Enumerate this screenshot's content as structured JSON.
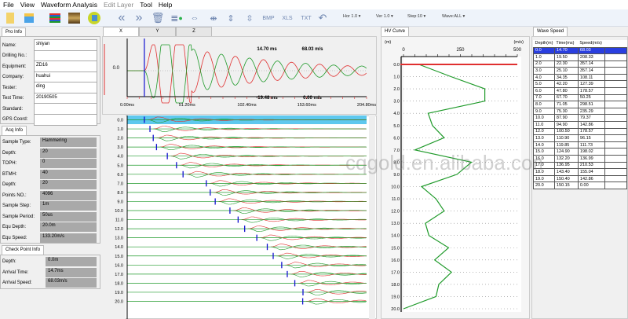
{
  "menu": [
    "File",
    "View",
    "Waveform Analysis",
    "Edit Layer",
    "Tool",
    "Help"
  ],
  "toolbar": {
    "icons": [
      "new-file-icon",
      "save-icon",
      "waveform-icon",
      "layer-image-icon",
      "report-icon",
      "prev-icon",
      "next-icon",
      "delete-icon",
      "add-layer-icon",
      "h-expand-icon",
      "h-shrink-icon",
      "v-expand-icon",
      "v-shrink-icon"
    ],
    "bmp": "BMP",
    "xls": "XLS",
    "txt": "TXT",
    "hor": "Hor 1.0",
    "ver": "Ver 1.0",
    "step": "Step:10",
    "wave": "Wave:ALL"
  },
  "pro_info": {
    "tab": "Pro Info",
    "fields": [
      {
        "label": "Name:",
        "value": "shiyan"
      },
      {
        "label": "Drilling No.:",
        "value": ""
      },
      {
        "label": "Equipment:",
        "value": "ZD16"
      },
      {
        "label": "Company:",
        "value": "huahui"
      },
      {
        "label": "Tester:",
        "value": "ding"
      },
      {
        "label": "Test Time:",
        "value": "20190505"
      },
      {
        "label": "Standard:",
        "value": ""
      },
      {
        "label": "GPS Coord:",
        "value": ""
      }
    ]
  },
  "acq_info": {
    "tab": "Acq Info",
    "fields": [
      {
        "label": "Sample Type:",
        "value": "Hammering"
      },
      {
        "label": "Depth:",
        "value": "20"
      },
      {
        "label": "TOPH:",
        "value": "0"
      },
      {
        "label": "BTMH:",
        "value": "40"
      },
      {
        "label": "Depth:",
        "value": "20"
      },
      {
        "label": "Points NO.:",
        "value": "4096"
      },
      {
        "label": "Sample Step:",
        "value": "1m"
      },
      {
        "label": "Sample Period:",
        "value": "50us"
      },
      {
        "label": "Equ Depth:",
        "value": "20.0m"
      },
      {
        "label": "Equ Speed:",
        "value": "133.20m/s"
      }
    ]
  },
  "check_point": {
    "tab": "Check Point Info",
    "fields": [
      {
        "label": "Depth:",
        "value": "0.0m"
      },
      {
        "label": "Arrival Time:",
        "value": "14.7ms"
      },
      {
        "label": "Arrival Speed:",
        "value": "68.03m/s"
      }
    ]
  },
  "wave_tabs": [
    "X",
    "Y",
    "Z"
  ],
  "top_wave": {
    "zero_label": "0.0",
    "time_top": "14.70 ms",
    "speed_top": "68.03 m/s",
    "time_bottom": "-19.48 ms",
    "speed_bottom": "0.00 m/s",
    "x_ticks": [
      "0.00ms",
      "51.20ms",
      "102.40ms",
      "153.60ms",
      "204.80ms"
    ],
    "x_max_ms": 204.8
  },
  "hv_curve": {
    "tab": "HV Curve",
    "y_unit": "(m)",
    "x_unit": "(m/s)",
    "x_ticks": [
      "0",
      "250",
      "500"
    ],
    "x_max": 500
  },
  "wave_speed": {
    "tab": "Wave Speed",
    "headers": [
      "Depth(m)",
      "Time(ms)",
      "Speed(m/s)"
    ],
    "rows": [
      [
        "0.0",
        "14.70",
        "68.03"
      ],
      [
        "1.0",
        "19.50",
        "208.33"
      ],
      [
        "2.0",
        "22.30",
        "357.14"
      ],
      [
        "3.0",
        "25.10",
        "357.14"
      ],
      [
        "4.0",
        "34.35",
        "108.11"
      ],
      [
        "5.0",
        "42.20",
        "127.39"
      ],
      [
        "6.0",
        "47.80",
        "178.57"
      ],
      [
        "7.0",
        "67.70",
        "50.25"
      ],
      [
        "8.0",
        "71.05",
        "298.51"
      ],
      [
        "9.0",
        "75.30",
        "235.29"
      ],
      [
        "10.0",
        "87.90",
        "79.37"
      ],
      [
        "11.0",
        "94.90",
        "142.86"
      ],
      [
        "12.0",
        "100.50",
        "178.57"
      ],
      [
        "13.0",
        "110.90",
        "96.15"
      ],
      [
        "14.0",
        "119.85",
        "111.73"
      ],
      [
        "15.0",
        "124.90",
        "198.02"
      ],
      [
        "16.0",
        "132.20",
        "136.99"
      ],
      [
        "17.0",
        "136.95",
        "210.53"
      ],
      [
        "18.0",
        "143.40",
        "155.04"
      ],
      [
        "19.0",
        "150.40",
        "142.86"
      ],
      [
        "20.0",
        "150.15",
        "0.00"
      ]
    ]
  },
  "watermark": "cqgold.en.alibaba.com",
  "colors": {
    "red": "#e03030",
    "green": "#1f9a2a",
    "blue": "#1010d0",
    "highlight": "#5ec8ee"
  }
}
